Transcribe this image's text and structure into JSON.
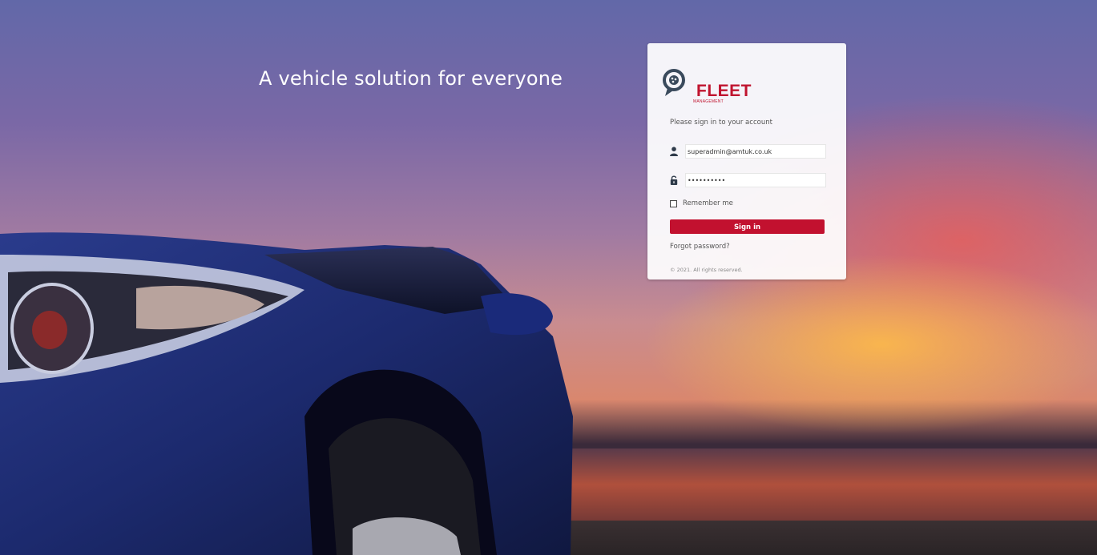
{
  "hero": {
    "tagline": "A vehicle solution for everyone"
  },
  "login": {
    "logo_text": "FLEET",
    "logo_subtext": "MANAGEMENT",
    "prompt": "Please sign in to your account",
    "email_value": "superadmin@amtuk.co.uk",
    "email_icon": "user-icon",
    "password_value": "••••••••••",
    "password_icon": "lock-icon",
    "remember_label": "Remember me",
    "remember_checked": false,
    "sign_in_label": "Sign in",
    "forgot_label": "Forgot password?",
    "copyright": "© 2021. All rights reserved."
  },
  "colors": {
    "brand": "#c2112f",
    "logo_pin": "#3a4a5c"
  }
}
